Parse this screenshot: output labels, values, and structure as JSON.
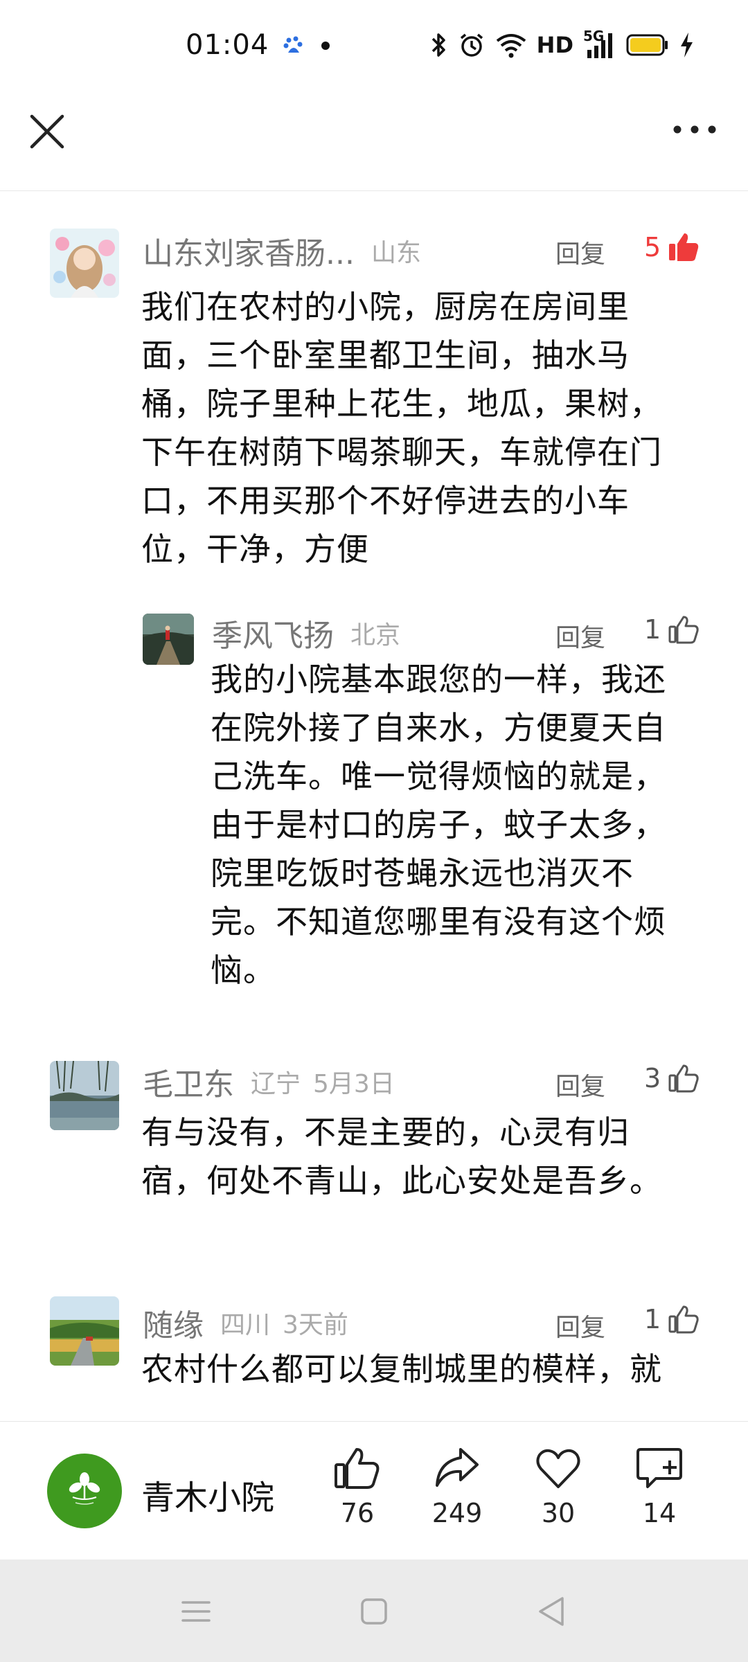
{
  "status_bar": {
    "time": "01:04",
    "hd_label": "HD",
    "net_label": "5G",
    "icons": [
      "baidu-icon",
      "dot-icon",
      "bluetooth-icon",
      "alarm-icon",
      "wifi-icon",
      "signal-icon",
      "battery-icon",
      "charging-icon"
    ]
  },
  "header": {
    "icons": [
      "close-icon",
      "more-icon"
    ]
  },
  "comments": [
    {
      "name": "山东刘家香肠...",
      "location": "山东",
      "time": "",
      "reply_label": "回复",
      "likes": "5",
      "liked": true,
      "text": "我们在农村的小院，厨房在房间里面，三个卧室里都卫生间，抽水马桶，院子里种上花生，地瓜，果树，下午在树荫下喝茶聊天，车就停在门口，不用买那个不好停进去的小车位，干净，方便",
      "lines": [
        "我们在农村的小院，厨房在房间里",
        "面，三个卧室里都卫生间，抽水马",
        "桶，院子里种上花生，地瓜，果树，",
        "下午在树荫下喝茶聊天，车就停在门",
        "口，不用买那个不好停进去的小车",
        "位，干净，方便"
      ]
    },
    {
      "name": "季风飞扬",
      "location": "北京",
      "time": "",
      "reply_label": "回复",
      "likes": "1",
      "liked": false,
      "text": "我的小院基本跟您的一样，我还在院外接了自来水，方便夏天自己洗车。唯一觉得烦恼的就是，由于是村口的房子，蚊子太多，院里吃饭时苍蝇永远也消灭不完。不知道您哪里有没有这个烦恼。",
      "lines": [
        "我的小院基本跟您的一样，我还",
        "在院外接了自来水，方便夏天自",
        "己洗车。唯一觉得烦恼的就是，",
        "由于是村口的房子，蚊子太多，",
        "院里吃饭时苍蝇永远也消灭不",
        "完。不知道您哪里有没有这个烦",
        "恼。"
      ]
    },
    {
      "name": "毛卫东",
      "location": "辽宁",
      "time": "5月3日",
      "reply_label": "回复",
      "likes": "3",
      "liked": false,
      "text": "有与没有，不是主要的，心灵有归宿，何处不青山，此心安处是吾乡。",
      "lines": [
        "有与没有，不是主要的，心灵有归",
        "宿，何处不青山，此心安处是吾乡。"
      ]
    },
    {
      "name": "随缘",
      "location": "四川",
      "time": "3天前",
      "reply_label": "回复",
      "likes": "1",
      "liked": false,
      "text": "农村什么都可以复制城里的模样，就",
      "lines": [
        "农村什么都可以复制城里的模样，就"
      ]
    }
  ],
  "action_bar": {
    "brand_name": "青木小院",
    "like_count": "76",
    "share_count": "249",
    "favorite_count": "30",
    "comment_count": "14"
  },
  "nav_bar": {
    "icons": [
      "menu-icon",
      "home-icon",
      "back-icon"
    ]
  },
  "colors": {
    "accent_red": "#ee3b3b",
    "brand_green": "#3f9a1f",
    "nav_bg": "#ebebeb"
  }
}
